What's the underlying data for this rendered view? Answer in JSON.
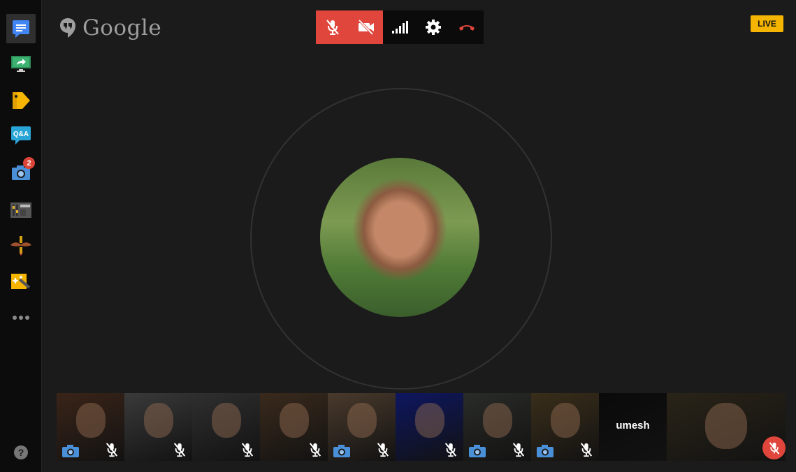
{
  "app": {
    "brand": "Google",
    "live_label": "LIVE"
  },
  "sidebar": {
    "items": [
      {
        "name": "chat",
        "icon": "chat-icon"
      },
      {
        "name": "screenshare",
        "icon": "screenshare-icon"
      },
      {
        "name": "lower-third",
        "icon": "tag-icon"
      },
      {
        "name": "qa",
        "icon": "qa-icon",
        "label": "Q&A"
      },
      {
        "name": "capture",
        "icon": "camera-icon",
        "badge": "2"
      },
      {
        "name": "control-room",
        "icon": "control-room-icon"
      },
      {
        "name": "effects",
        "icon": "mustache-icon"
      },
      {
        "name": "hangout-toolbox",
        "icon": "magic-wand-icon"
      },
      {
        "name": "more",
        "icon": "more-icon"
      }
    ],
    "help": "?"
  },
  "toolbar": {
    "buttons": [
      {
        "name": "mute-mic",
        "icon": "mic-off-icon",
        "state": "active"
      },
      {
        "name": "mute-video",
        "icon": "video-off-icon",
        "state": "active"
      },
      {
        "name": "bandwidth",
        "icon": "signal-icon"
      },
      {
        "name": "settings",
        "icon": "gear-icon"
      },
      {
        "name": "hang-up",
        "icon": "hang-up-icon"
      }
    ]
  },
  "participants": [
    {
      "camera_off": true,
      "mic_muted": true,
      "tint": "#3a2418"
    },
    {
      "camera_off": false,
      "mic_muted": true,
      "tint": "#3a3a3a"
    },
    {
      "camera_off": false,
      "mic_muted": true,
      "tint": "#2f2f2f"
    },
    {
      "camera_off": false,
      "mic_muted": true,
      "tint": "#3a2a1c"
    },
    {
      "camera_off": true,
      "mic_muted": true,
      "tint": "#4a3a2c"
    },
    {
      "camera_off": false,
      "mic_muted": true,
      "tint": "#0d1660"
    },
    {
      "camera_off": true,
      "mic_muted": true,
      "tint": "#2a2c28"
    },
    {
      "camera_off": true,
      "mic_muted": true,
      "tint": "#3a2e1a"
    },
    {
      "camera_off": false,
      "mic_muted": false,
      "tint": "#0a0a0a",
      "name": "umesh"
    },
    {
      "camera_off": false,
      "mic_muted": false,
      "tint": "#2a2418",
      "self": true
    }
  ],
  "colors": {
    "accent_red": "#e0463b",
    "live_yellow": "#f4b400",
    "background": "#1b1b1b"
  }
}
